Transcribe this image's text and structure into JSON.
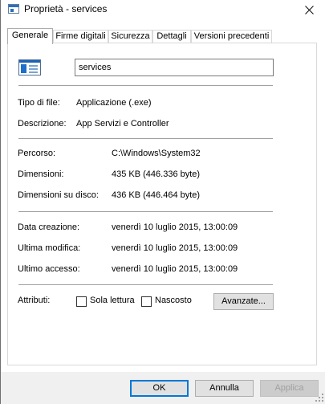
{
  "window": {
    "title": "Proprietà - services",
    "icon": "properties-window-icon",
    "close_icon": "close-icon"
  },
  "tabs": [
    {
      "label": "Generale",
      "active": true
    },
    {
      "label": "Firme digitali",
      "active": false
    },
    {
      "label": "Sicurezza",
      "active": false
    },
    {
      "label": "Dettagli",
      "active": false
    },
    {
      "label": "Versioni precedenti",
      "active": false
    }
  ],
  "general": {
    "file_name": "services",
    "file_type_label": "Tipo di file:",
    "file_type_value": "Applicazione (.exe)",
    "description_label": "Descrizione:",
    "description_value": "App Servizi e Controller",
    "location_label": "Percorso:",
    "location_value": "C:\\Windows\\System32",
    "size_label": "Dimensioni:",
    "size_value": "435 KB (446.336 byte)",
    "size_on_disk_label": "Dimensioni su disco:",
    "size_on_disk_value": "436 KB (446.464 byte)",
    "created_label": "Data creazione:",
    "created_value": "venerdì 10 luglio 2015, 13:00:09",
    "modified_label": "Ultima modifica:",
    "modified_value": "venerdì 10 luglio 2015, 13:00:09",
    "accessed_label": "Ultimo accesso:",
    "accessed_value": "venerdì 10 luglio 2015, 13:00:09",
    "attributes_label": "Attributi:",
    "readonly_label": "Sola lettura",
    "readonly_checked": false,
    "hidden_label": "Nascosto",
    "hidden_checked": false,
    "advanced_button": "Avanzate..."
  },
  "footer": {
    "ok": "OK",
    "cancel": "Annulla",
    "apply": "Applica"
  },
  "colors": {
    "accent": "#0078d7",
    "button_bg": "#e1e1e1",
    "footer_bg": "#f0f0f0"
  }
}
